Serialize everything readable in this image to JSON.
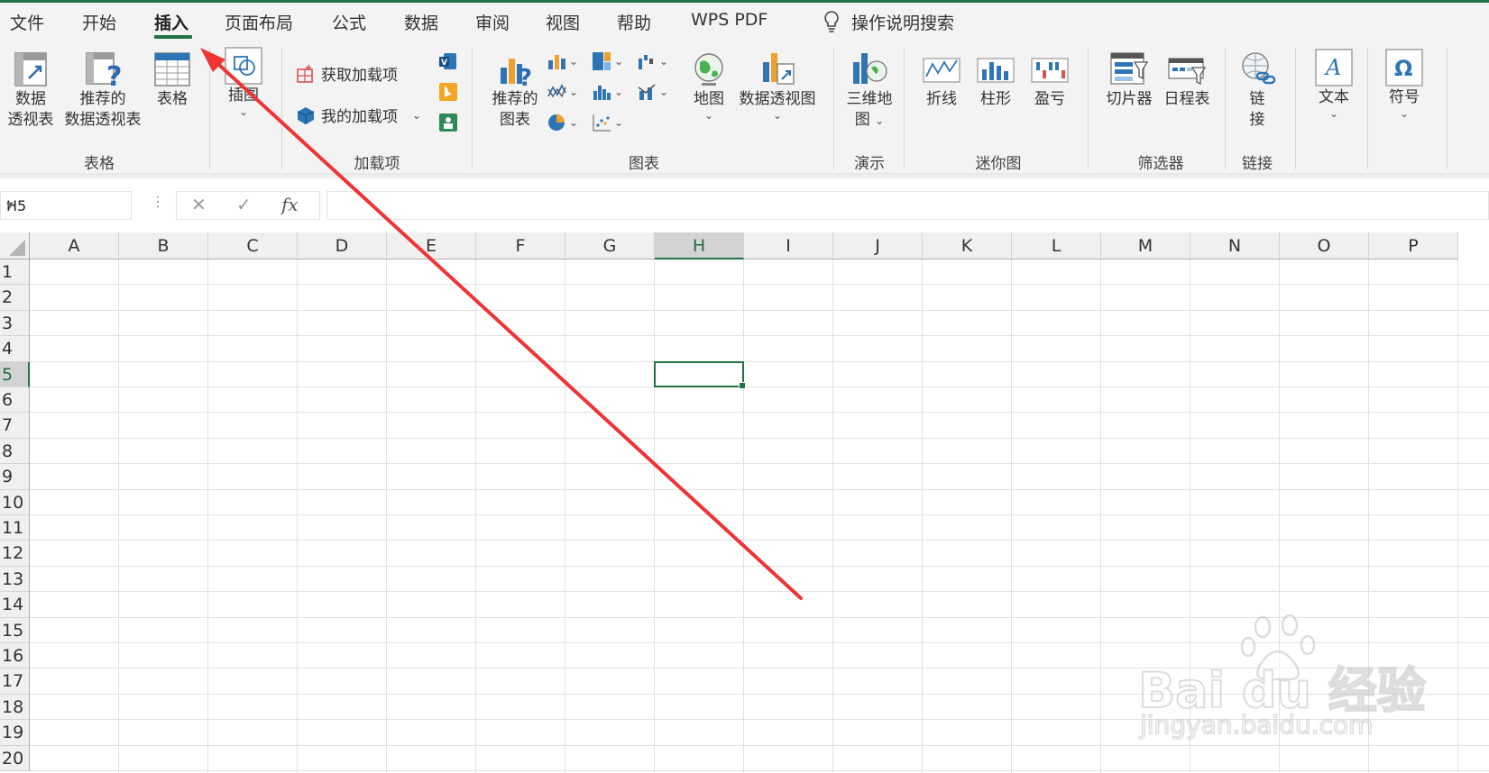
{
  "tabs": [
    {
      "label": "文件"
    },
    {
      "label": "开始"
    },
    {
      "label": "插入"
    },
    {
      "label": "页面布局"
    },
    {
      "label": "公式"
    },
    {
      "label": "数据"
    },
    {
      "label": "审阅"
    },
    {
      "label": "视图"
    },
    {
      "label": "帮助"
    },
    {
      "label": "WPS PDF"
    }
  ],
  "active_tab": "插入",
  "tell_me": "操作说明搜索",
  "ribbon": {
    "table_group": {
      "label": "表格",
      "pivot_table_1": "数据",
      "pivot_table_2": "透视表",
      "recommended_pivot_1": "推荐的",
      "recommended_pivot_2": "数据透视表",
      "table": "表格"
    },
    "illustrations": {
      "label": "插图"
    },
    "addins_group": {
      "label": "加载项",
      "get_addins": "获取加载项",
      "my_addins": "我的加载项"
    },
    "charts_group": {
      "label": "图表",
      "recommended_1": "推荐的",
      "recommended_2": "图表",
      "map": "地图",
      "pivot_chart": "数据透视图"
    },
    "tours_group": {
      "label": "演示",
      "map3d_1": "三维地",
      "map3d_2": "图"
    },
    "sparklines_group": {
      "label": "迷你图",
      "line": "折线",
      "column": "柱形",
      "winloss": "盈亏"
    },
    "filters_group": {
      "label": "筛选器",
      "slicer": "切片器",
      "timeline": "日程表"
    },
    "links_group": {
      "label": "链接",
      "link_1": "链",
      "link_2": "接"
    },
    "text": {
      "label": "文本"
    },
    "symbols": {
      "label": "符号"
    }
  },
  "formula_bar": {
    "name_box": "H5",
    "fx": "fx",
    "value": ""
  },
  "columns": [
    "A",
    "B",
    "C",
    "D",
    "E",
    "F",
    "G",
    "H",
    "I",
    "J",
    "K",
    "L",
    "M",
    "N",
    "O",
    "P"
  ],
  "rows": [
    "1",
    "2",
    "3",
    "4",
    "5",
    "6",
    "7",
    "8",
    "9",
    "10",
    "11",
    "12",
    "13",
    "14",
    "15",
    "16",
    "17",
    "18",
    "19",
    "20"
  ],
  "selected_cell": {
    "column": "H",
    "row": "5"
  },
  "annotation": {
    "color": "#ee3434"
  },
  "watermark": {
    "brand": "Bai du 经验",
    "url": "jingyan.baidu.com"
  }
}
